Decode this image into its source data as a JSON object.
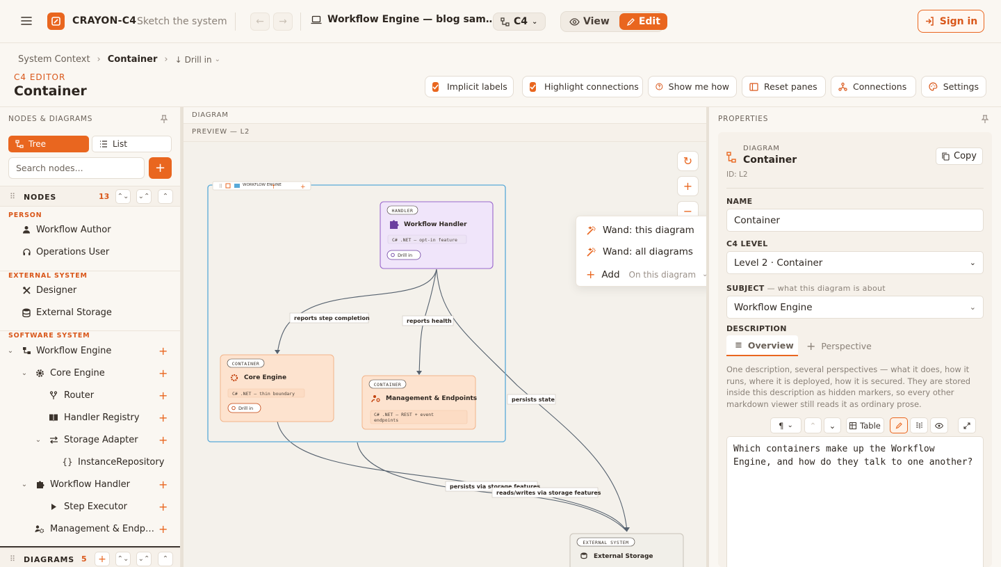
{
  "app": {
    "brand": "CRAYON-C4",
    "tagline": "Sketch the system",
    "doc_title": "Workflow Engine — blog sam…",
    "notation": "C4",
    "mode_view": "View",
    "mode_edit": "Edit",
    "sign_in": "Sign in",
    "accent": "#e9661f"
  },
  "breadcrumb": {
    "items": [
      "System Context",
      "Container"
    ],
    "drill": "Drill in"
  },
  "page": {
    "eyebrow": "C4 EDITOR",
    "title": "Container"
  },
  "toolbar": {
    "implicit_labels": "Implicit labels",
    "highlight_connections": "Highlight connections",
    "show_me_how": "Show me how",
    "reset_panes": "Reset panes",
    "connections": "Connections",
    "settings": "Settings"
  },
  "left": {
    "header": "NODES & DIAGRAMS",
    "tab_tree": "Tree",
    "tab_list": "List",
    "search_placeholder": "Search nodes...",
    "nodes_label": "NODES",
    "nodes_count": "13",
    "diagrams_label": "DIAGRAMS",
    "diagrams_count": "5",
    "groups": [
      "PERSON",
      "EXTERNAL SYSTEM",
      "SOFTWARE SYSTEM"
    ],
    "items": [
      {
        "label": "Workflow Author",
        "icon": "person-icon"
      },
      {
        "label": "Operations User",
        "icon": "headset-icon"
      },
      {
        "label": "Designer",
        "icon": "tools-icon"
      },
      {
        "label": "External Storage",
        "icon": "database-icon"
      },
      {
        "label": "Workflow Engine",
        "icon": "system-icon"
      },
      {
        "label": "Core Engine",
        "icon": "gear-icon"
      },
      {
        "label": "Router",
        "icon": "fork-icon"
      },
      {
        "label": "Handler Registry",
        "icon": "book-icon"
      },
      {
        "label": "Storage Adapter",
        "icon": "swap-icon"
      },
      {
        "label": "InstanceRepository",
        "icon": "braces-icon"
      },
      {
        "label": "Workflow Handler",
        "icon": "puzzle-icon"
      },
      {
        "label": "Step Executor",
        "icon": "play-icon"
      },
      {
        "label": "Management & Endp…",
        "icon": "people-gear-icon"
      }
    ]
  },
  "center": {
    "header": "DIAGRAM",
    "preview": "PREVIEW — L2",
    "boundary_label": "WORKFLOW ENGINE",
    "nodes": {
      "handler": {
        "tag": "HANDLER",
        "title": "Workflow Handler",
        "tech": "C# .NET — opt-in feature",
        "drill": "Drill in"
      },
      "core": {
        "tag": "CONTAINER",
        "title": "Core Engine",
        "tech": "C# .NET — thin boundary",
        "drill": "Drill in"
      },
      "mgmt": {
        "tag": "CONTAINER",
        "title": "Management & Endpoints",
        "tech1": "C# .NET — REST + event",
        "tech2": "endpoints"
      },
      "ext": {
        "tag": "EXTERNAL SYSTEM",
        "title": "External Storage"
      }
    },
    "edges": [
      "reports step completion",
      "reports health",
      "persists state",
      "persists via storage features",
      "reads/writes via storage features"
    ],
    "menu": {
      "wand_this": "Wand: this diagram",
      "wand_all": "Wand: all diagrams",
      "add": "Add",
      "add_hint": "On this diagram"
    }
  },
  "right": {
    "header": "PROPERTIES",
    "kind": "DIAGRAM",
    "name_display": "Container",
    "id": "ID: L2",
    "copy": "Copy",
    "name_label": "NAME",
    "name_value": "Container",
    "level_label": "C4 LEVEL",
    "level_value": "Level 2 · Container",
    "subject_label": "SUBJECT",
    "subject_hint": "— what this diagram is about",
    "subject_value": "Workflow Engine",
    "desc_label": "DESCRIPTION",
    "tab_overview": "Overview",
    "tab_perspective": "Perspective",
    "desc_help": "One description, several perspectives — what it does, how it runs, where it is deployed, how it is secured. They are stored inside this description as hidden markers, so every other markdown viewer still reads it as ordinary prose.",
    "para": "¶",
    "table": "Table",
    "editor_text": "Which containers make up the Workflow Engine, and how do they talk to one another?"
  }
}
